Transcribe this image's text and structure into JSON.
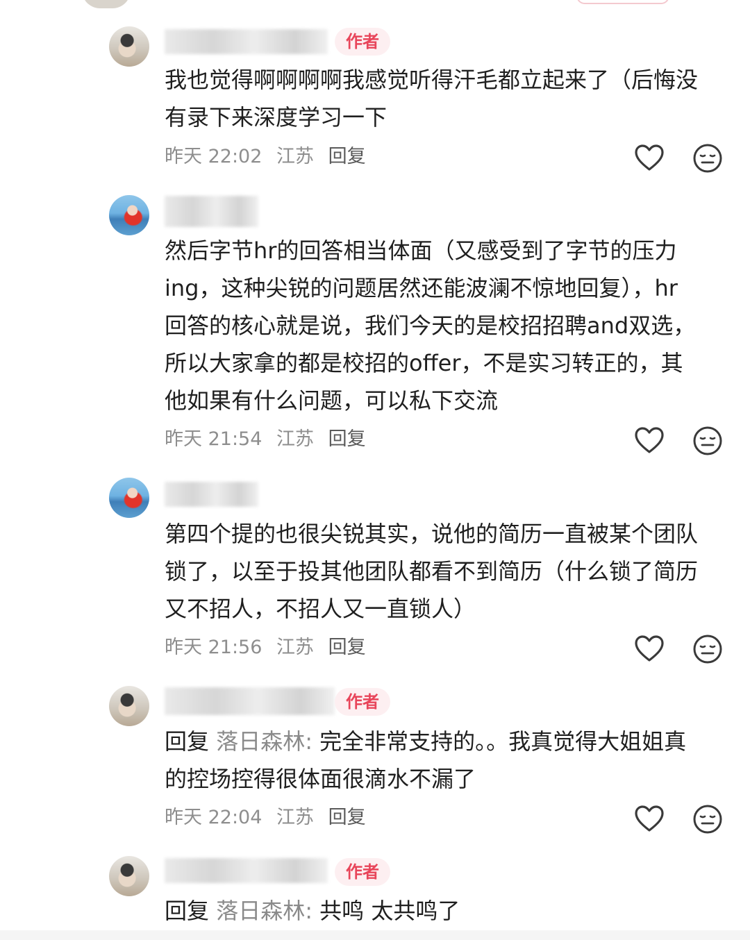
{
  "comments": [
    {
      "author_badge": "作者",
      "content": "我也觉得啊啊啊啊我感觉听得汗毛都立起来了（后悔没有录下来深度学习一下",
      "time": "昨天 22:02",
      "location": "江苏",
      "reply": "回复"
    },
    {
      "content": "然后字节hr的回答相当体面（又感受到了字节的压力ing，这种尖锐的问题居然还能波澜不惊地回复），hr回答的核心就是说，我们今天的是校招招聘and双选，所以大家拿的都是校招的offer，不是实习转正的，其他如果有什么问题，可以私下交流",
      "time": "昨天 21:54",
      "location": "江苏",
      "reply": "回复"
    },
    {
      "content": "第四个提的也很尖锐其实，说他的简历一直被某个团队锁了，以至于投其他团队都看不到简历（什么锁了简历又不招人，不招人又一直锁人）",
      "time": "昨天 21:56",
      "location": "江苏",
      "reply": "回复"
    },
    {
      "author_badge": "作者",
      "reply_prefix": "回复",
      "reply_target": "落日森林:",
      "content": "完全非常支持的。。我真觉得大姐姐真的控场控得很体面很滴水不漏了",
      "time": "昨天 22:04",
      "location": "江苏",
      "reply": "回复"
    },
    {
      "author_badge": "作者",
      "reply_prefix": "回复",
      "reply_target": "落日森林:",
      "content": "共鸣 太共鸣了"
    }
  ],
  "icons": {
    "like": "heart-outline-icon",
    "dislike": "neutral-face-icon"
  },
  "colors": {
    "badge_text": "#e8455a",
    "badge_bg": "#fdeff1",
    "meta": "#8e8e8e"
  }
}
